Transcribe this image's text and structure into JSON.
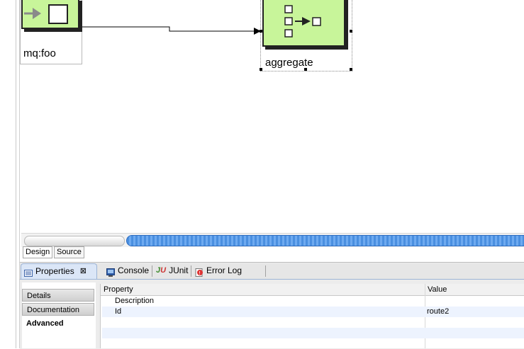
{
  "diagram": {
    "nodes": [
      {
        "label": "mq:foo",
        "icon": "endpoint-icon"
      },
      {
        "label": "aggregate",
        "icon": "aggregate-icon"
      }
    ]
  },
  "editor_tabs": {
    "design": "Design",
    "source": "Source"
  },
  "views": {
    "tabs": [
      {
        "label": "Properties",
        "icon": "properties-icon",
        "active": true
      },
      {
        "label": "Console",
        "icon": "console-icon"
      },
      {
        "label": "JUnit",
        "icon": "junit-icon"
      },
      {
        "label": "Error Log",
        "icon": "error-log-icon"
      }
    ]
  },
  "properties": {
    "sections": [
      "Details",
      "Documentation",
      "Advanced"
    ],
    "selected_section": "Advanced",
    "columns": {
      "property": "Property",
      "value": "Value"
    },
    "rows": [
      {
        "property": "Description",
        "value": ""
      },
      {
        "property": "Id",
        "value": "route2"
      }
    ]
  },
  "colors": {
    "node_fill": "#c8f59a",
    "accent": "#4a8fe0"
  }
}
